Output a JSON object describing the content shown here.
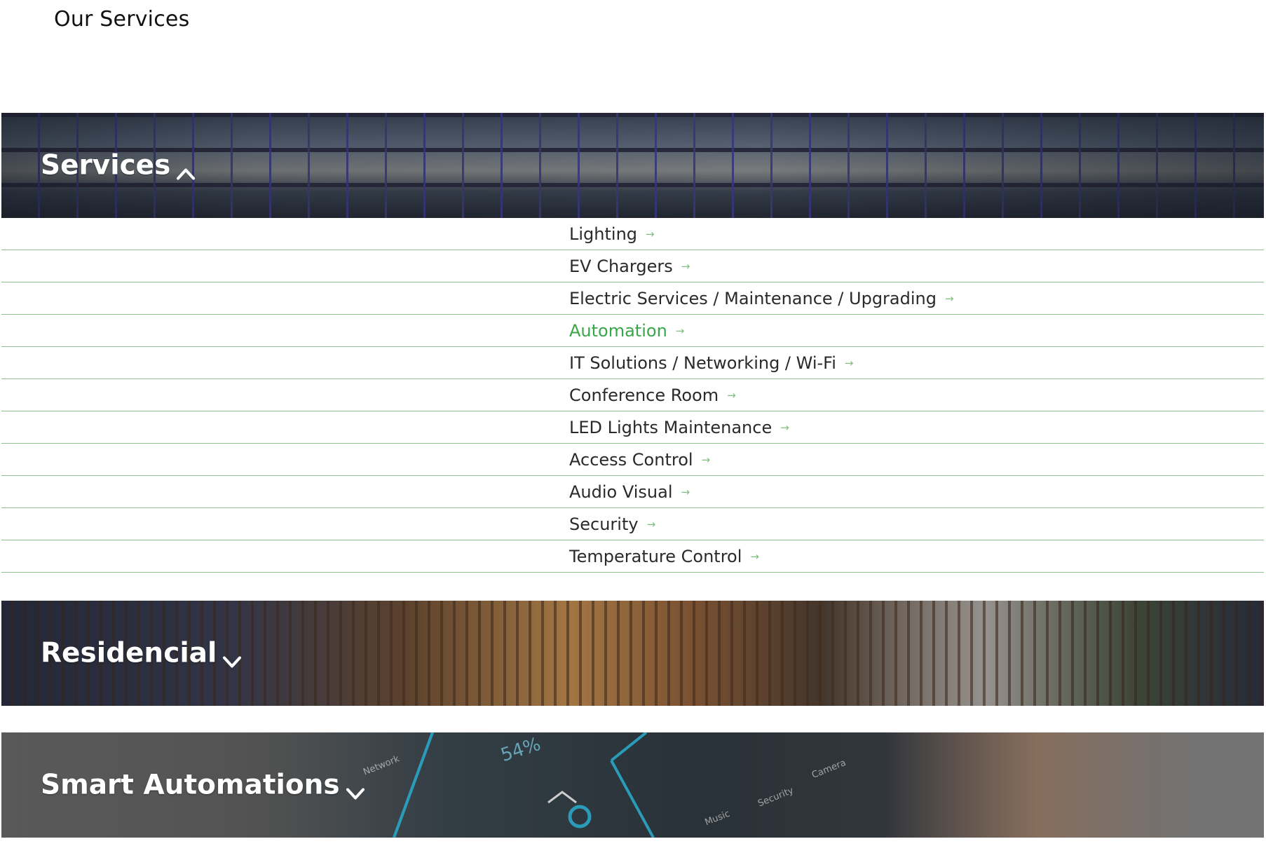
{
  "page": {
    "title": "Our Services"
  },
  "sections": {
    "services": {
      "title": "Services",
      "expanded": true
    },
    "residencial": {
      "title": "Residencial",
      "expanded": false
    },
    "smart": {
      "title": "Smart Automations",
      "expanded": false
    }
  },
  "services_list": [
    {
      "label": "Lighting",
      "active": false
    },
    {
      "label": "EV Chargers",
      "active": false
    },
    {
      "label": "Electric Services / Maintenance / Upgrading",
      "active": false
    },
    {
      "label": "Automation",
      "active": true
    },
    {
      "label": "IT Solutions / Networking / Wi-Fi",
      "active": false
    },
    {
      "label": "Conference Room",
      "active": false
    },
    {
      "label": "LED Lights Maintenance",
      "active": false
    },
    {
      "label": "Access Control",
      "active": false
    },
    {
      "label": "Audio Visual",
      "active": false
    },
    {
      "label": "Security",
      "active": false
    },
    {
      "label": "Temperature Control",
      "active": false
    }
  ],
  "arrow_glyph": "→",
  "phone_screen": {
    "percent": "54%",
    "labels": [
      "Network",
      "Music",
      "Security",
      "Camera"
    ]
  },
  "colors": {
    "accent_green": "#3aa64a",
    "divider_green": "#8fbf8f",
    "text": "#2a2a2a"
  }
}
